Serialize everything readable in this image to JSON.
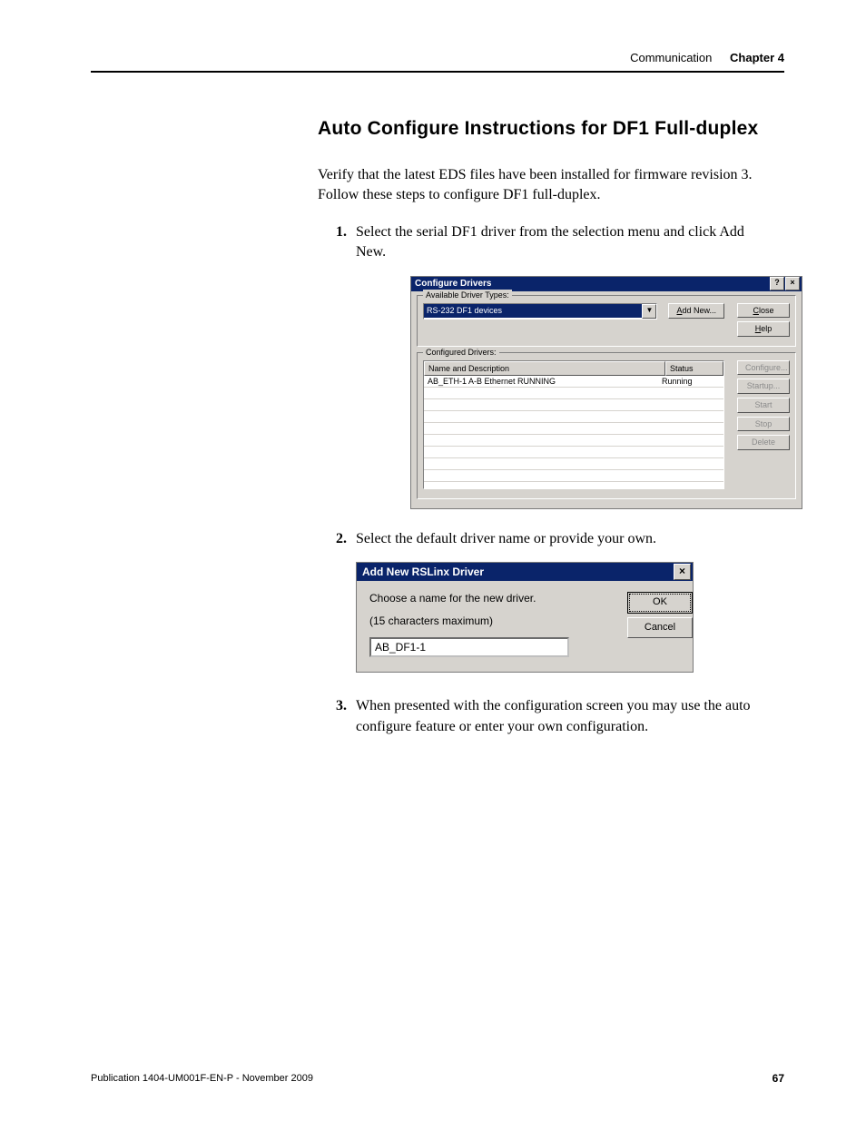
{
  "header": {
    "section": "Communication",
    "chapter": "Chapter 4"
  },
  "title": "Auto Configure Instructions for DF1 Full-duplex",
  "intro": "Verify that the latest EDS files have been installed for firmware revision 3. Follow these steps to configure DF1 full-duplex.",
  "steps": {
    "s1": "Select the serial DF1 driver from the selection menu and click Add New.",
    "s2": "Select the default driver name or provide your own.",
    "s3": "When presented with the configuration screen you may use the auto configure feature or enter your own configuration."
  },
  "dlg1": {
    "title": "Configure Drivers",
    "group_available": "Available Driver Types:",
    "combo_value": "RS-232 DF1 devices",
    "btn_add_new": "Add New...",
    "btn_close": "Close",
    "btn_help": "Help",
    "group_configured": "Configured Drivers:",
    "col_name": "Name and Description",
    "col_status": "Status",
    "rows": [
      {
        "name": "AB_ETH-1  A-B Ethernet  RUNNING",
        "status": "Running"
      }
    ],
    "btn_configure": "Configure...",
    "btn_startup": "Startup...",
    "btn_start": "Start",
    "btn_stop": "Stop",
    "btn_delete": "Delete"
  },
  "dlg2": {
    "title": "Add New RSLinx Driver",
    "prompt1": "Choose a name for the new driver.",
    "prompt2": "(15 characters maximum)",
    "value": "AB_DF1-1",
    "btn_ok": "OK",
    "btn_cancel": "Cancel"
  },
  "footer": {
    "publication": "Publication 1404-UM001F-EN-P - November 2009",
    "page": "67"
  }
}
